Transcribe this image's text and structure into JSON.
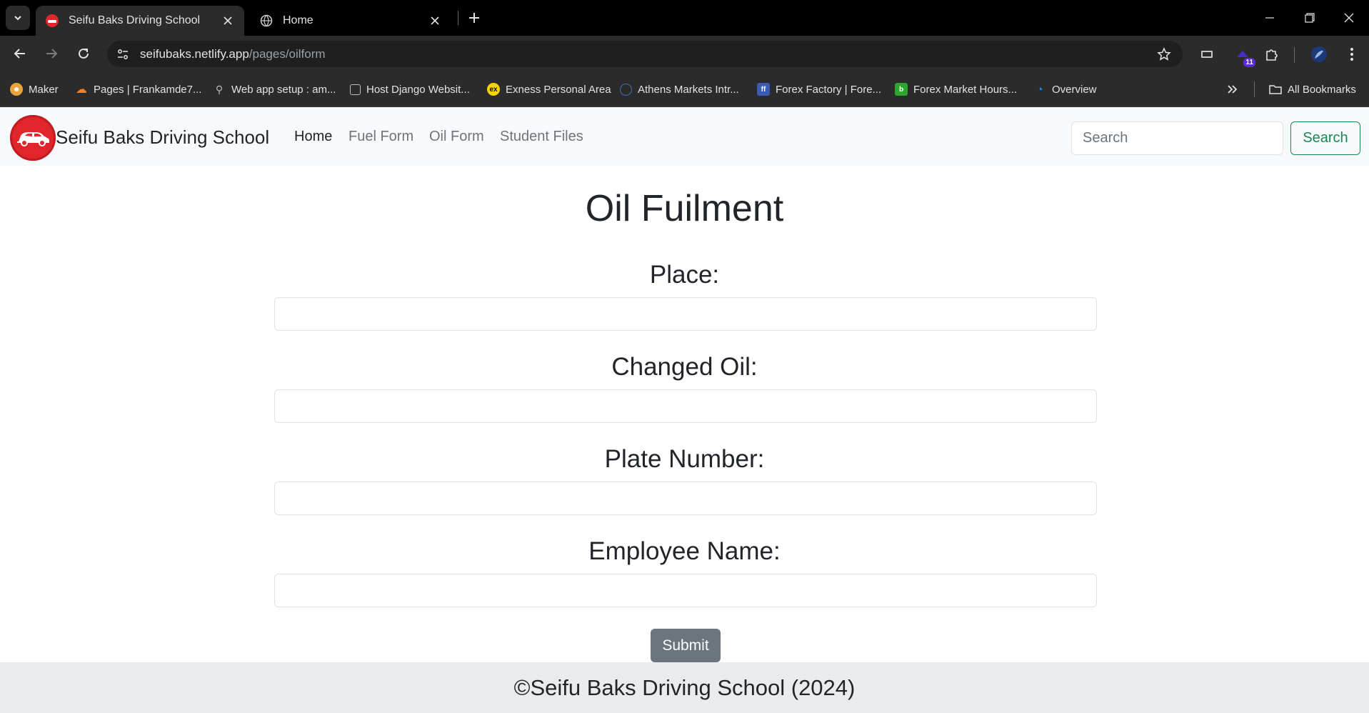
{
  "browser": {
    "tabs": [
      {
        "title": "Seifu Baks Driving School",
        "active": true
      },
      {
        "title": "Home",
        "active": false
      }
    ],
    "url_host": "seifubaks.netlify.app",
    "url_path": "/pages/oilform",
    "extension_badge": "11",
    "bookmarks": [
      {
        "label": "Maker",
        "icon": "maker-icon",
        "color": "#e8a33c"
      },
      {
        "label": "Pages | Frankamde7...",
        "icon": "cloudflare-icon",
        "color": "#f38020"
      },
      {
        "label": "Web app setup : am...",
        "icon": "link-icon",
        "color": "#bdbdbd"
      },
      {
        "label": "Host Django Websit...",
        "icon": "page-icon",
        "color": "#bdbdbd"
      },
      {
        "label": "Exness Personal Area",
        "icon": "exness-icon",
        "color": "#f5d400"
      },
      {
        "label": "Athens Markets Intr...",
        "icon": "globe-icon",
        "color": "#3a6fb0"
      },
      {
        "label": "Forex Factory | Fore...",
        "icon": "forexfactory-icon",
        "color": "#3b5bb5"
      },
      {
        "label": "Forex Market Hours...",
        "icon": "b-icon",
        "color": "#2fa52f"
      },
      {
        "label": "Overview",
        "icon": "overview-icon",
        "color": "#1a8cff"
      }
    ],
    "all_bookmarks": "All Bookmarks"
  },
  "navbar": {
    "brand": "Seifu Baks Driving School",
    "links": [
      "Home",
      "Fuel Form",
      "Oil Form",
      "Student Files"
    ],
    "search_placeholder": "Search",
    "search_button": "Search"
  },
  "form": {
    "title": "Oil Fuilment",
    "fields": [
      {
        "label": "Place:",
        "value": ""
      },
      {
        "label": "Changed Oil:",
        "value": ""
      },
      {
        "label": "Plate Number:",
        "value": ""
      },
      {
        "label": "Employee Name:",
        "value": ""
      }
    ],
    "submit": "Submit"
  },
  "footer": {
    "text": "©Seifu Baks Driving School (2024)"
  },
  "colors": {
    "brand_red": "#e0262a",
    "success": "#198754",
    "secondary": "#6c757d"
  }
}
